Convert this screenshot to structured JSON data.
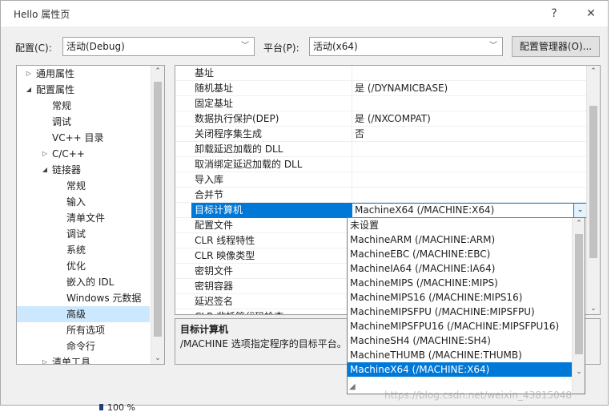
{
  "window": {
    "title": "Hello 属性页",
    "help_icon": "?",
    "close_icon": "✕"
  },
  "config_bar": {
    "config_label": "配置(C):",
    "config_value": "活动(Debug)",
    "platform_label": "平台(P):",
    "platform_value": "活动(x64)",
    "manager_button": "配置管理器(O)..."
  },
  "tree": {
    "items": [
      {
        "label": "通用属性",
        "expander": "▷"
      },
      {
        "label": "配置属性",
        "expander": "◢"
      },
      {
        "label": "常规",
        "expander": ""
      },
      {
        "label": "调试",
        "expander": ""
      },
      {
        "label": "VC++ 目录",
        "expander": ""
      },
      {
        "label": "C/C++",
        "expander": "▷"
      },
      {
        "label": "链接器",
        "expander": "◢"
      },
      {
        "label": "常规",
        "expander": ""
      },
      {
        "label": "输入",
        "expander": ""
      },
      {
        "label": "清单文件",
        "expander": ""
      },
      {
        "label": "调试",
        "expander": ""
      },
      {
        "label": "系统",
        "expander": ""
      },
      {
        "label": "优化",
        "expander": ""
      },
      {
        "label": "嵌入的 IDL",
        "expander": ""
      },
      {
        "label": "Windows 元数据",
        "expander": ""
      },
      {
        "label": "高级",
        "expander": ""
      },
      {
        "label": "所有选项",
        "expander": ""
      },
      {
        "label": "命令行",
        "expander": ""
      },
      {
        "label": "清单工具",
        "expander": "▷"
      }
    ]
  },
  "grid": {
    "rows": [
      {
        "name": "基址",
        "value": ""
      },
      {
        "name": "随机基址",
        "value": "是 (/DYNAMICBASE)"
      },
      {
        "name": "固定基址",
        "value": ""
      },
      {
        "name": "数据执行保护(DEP)",
        "value": "是 (/NXCOMPAT)"
      },
      {
        "name": "关闭程序集生成",
        "value": "否"
      },
      {
        "name": "卸载延迟加载的 DLL",
        "value": ""
      },
      {
        "name": "取消绑定延迟加载的 DLL",
        "value": ""
      },
      {
        "name": "导入库",
        "value": ""
      },
      {
        "name": "合并节",
        "value": ""
      },
      {
        "name": "目标计算机",
        "value": "MachineX64 (/MACHINE:X64)"
      },
      {
        "name": "配置文件",
        "value": ""
      },
      {
        "name": "CLR 线程特性",
        "value": ""
      },
      {
        "name": "CLR 映像类型",
        "value": ""
      },
      {
        "name": "密钥文件",
        "value": ""
      },
      {
        "name": "密钥容器",
        "value": ""
      },
      {
        "name": "延迟签名",
        "value": ""
      },
      {
        "name": "CLR 非托管代码检查",
        "value": ""
      }
    ]
  },
  "description": {
    "title": "目标计算机",
    "text": "/MACHINE 选项指定程序的目标平台。"
  },
  "dropdown": {
    "options": [
      "未设置",
      "MachineARM (/MACHINE:ARM)",
      "MachineEBC (/MACHINE:EBC)",
      "MachineIA64 (/MACHINE:IA64)",
      "MachineMIPS (/MACHINE:MIPS)",
      "MachineMIPS16 (/MACHINE:MIPS16)",
      "MachineMIPSFPU (/MACHINE:MIPSFPU)",
      "MachineMIPSFPU16 (/MACHINE:MIPSFPU16)",
      "MachineSH4 (/MACHINE:SH4)",
      "MachineTHUMB (/MACHINE:THUMB)",
      "MachineX64 (/MACHINE:X64)"
    ],
    "selected": "MachineX64 (/MACHINE:X64)"
  },
  "status": {
    "zoom": "100 %"
  },
  "watermark": "https://blog.csdn.net/weixin_43815048",
  "colors": {
    "accent": "#0078d7",
    "tree_selected": "#cce8ff"
  }
}
